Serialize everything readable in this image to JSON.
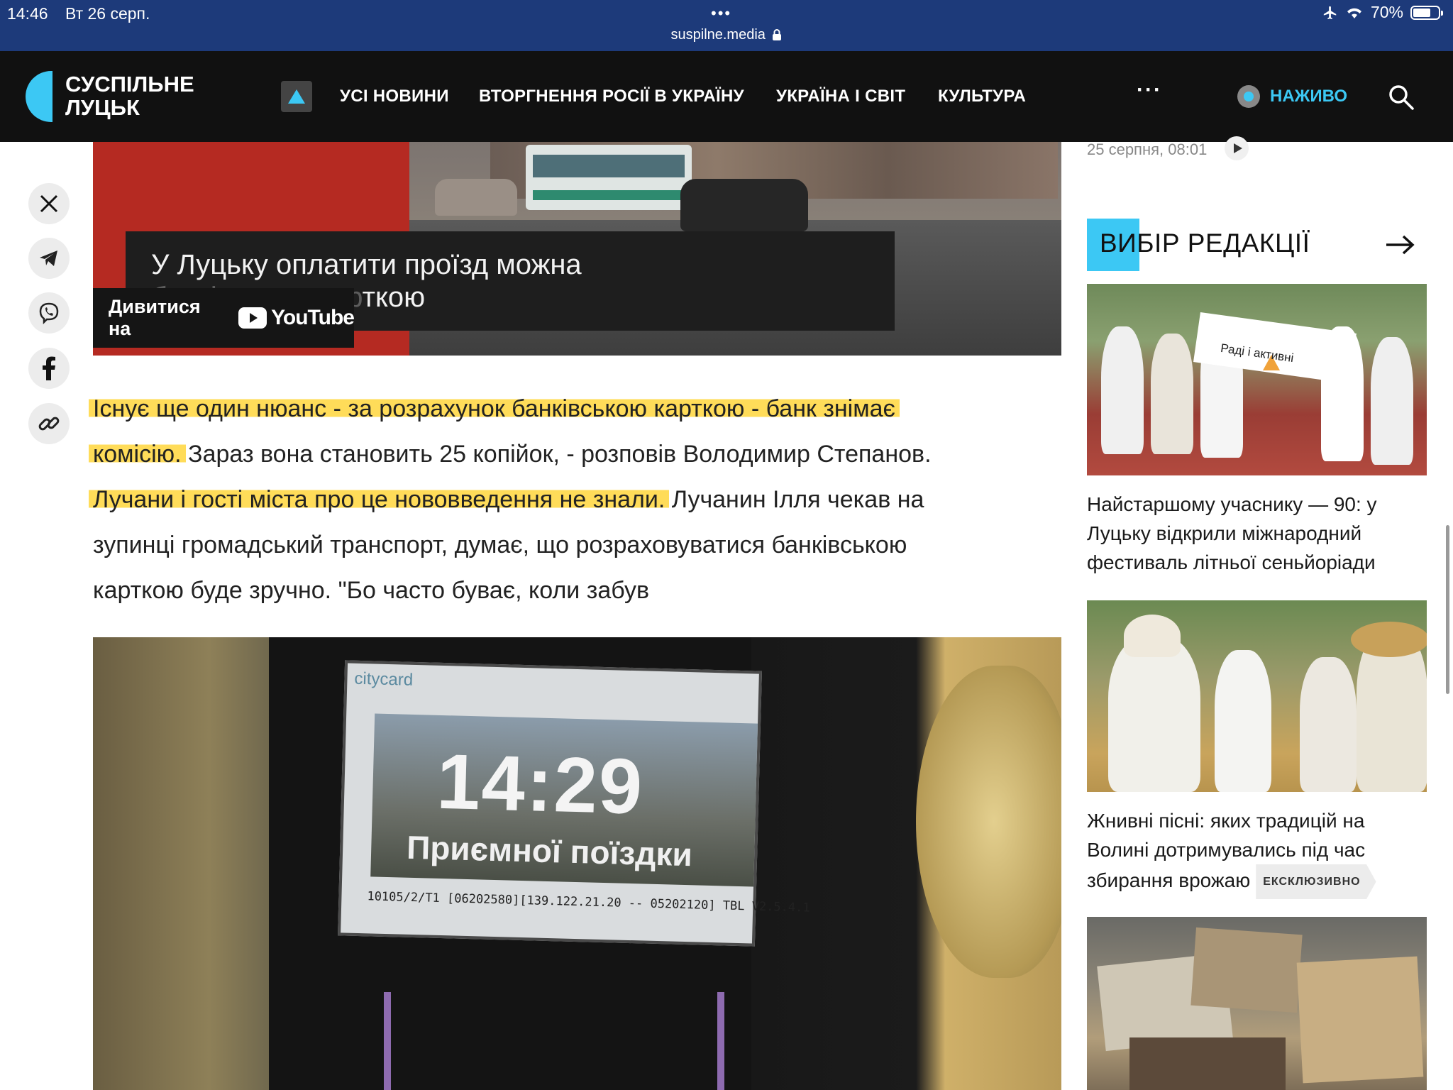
{
  "status_bar": {
    "time": "14:46",
    "date": "Вт 26 серп.",
    "dots": "•••",
    "url": "suspilne.media",
    "battery": "70%",
    "battery_level": 0.7
  },
  "header": {
    "logo_line1": "СУСПІЛЬНЕ",
    "logo_line2": "ЛУЦЬК",
    "nav": [
      "УСІ НОВИНИ",
      "ВТОРГНЕННЯ РОСІЇ В УКРАЇНУ",
      "УКРАЇНА І СВІТ",
      "КУЛЬТУРА"
    ],
    "more": "···",
    "live_label": "НАЖИВО"
  },
  "colors": {
    "accent": "#3cc8f4",
    "header_bg": "#111111",
    "status_bg": "#1d3a7a",
    "highlight": "#ffd63c"
  },
  "share": [
    "x-icon",
    "telegram-icon",
    "viber-icon",
    "facebook-icon",
    "link-icon"
  ],
  "video": {
    "caption_line1": "У Луцьку оплатити проїзд можна",
    "caption_line2_faded": "банківською кар",
    "caption_line2": "ткою",
    "watch_on": "Дивитися на",
    "youtube": "YouTube"
  },
  "article": {
    "line1_hl": "Існує ще один нюанс - за розрахунок банківською карткою - банк знімає",
    "line2_hl": "комісію.",
    "line2_rest": " Зараз вона становить 25 копійок, - розповів Володимир Степанов.",
    "line3_hl": "Лучани і гості міста про це нововведення не знали.",
    "line3_rest": " Лучанин Ілля чекав на",
    "line4": "зупинці громадський транспорт, думає, що розраховуватися банківською",
    "line5": "карткою буде зручно. \"Бо часто буває, коли забув"
  },
  "photo2": {
    "brand": "citycard",
    "clock": "14:29",
    "message": "Приємної поїздки",
    "info": "10105/2/T1    [06202580][139.122.21.20 -- 05202120]   TBL V2.5.4.1"
  },
  "sidebar": {
    "prev_time": "25 серпня, 08:01",
    "editors_title": "ВИБІР РЕДАКЦІЇ",
    "cards": [
      {
        "title": "Найстаршому учаснику — 90: у Луцьку відкрили міжнародний фестиваль літньої сеньйоріади",
        "banner": "Раді і активні"
      },
      {
        "title": "Жнивні пісні: яких традицій на Волині дотримувались під час збирання врожаю",
        "badge": "ЕКСКЛЮЗИВНО"
      },
      {
        "title": ""
      }
    ]
  }
}
